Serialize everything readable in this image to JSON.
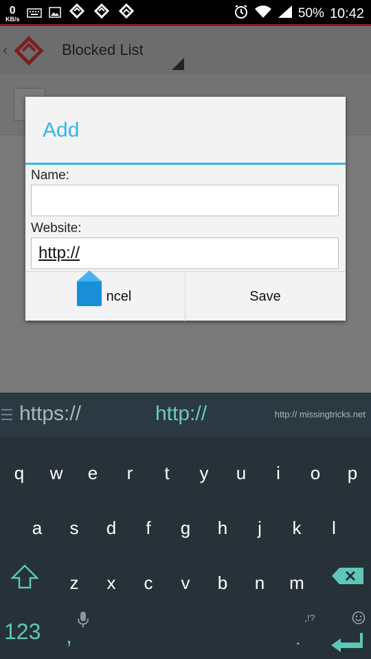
{
  "status_bar": {
    "kbs_value": "0",
    "kbs_unit": "KB/s",
    "battery": "50%",
    "time": "10:42"
  },
  "app_bar": {
    "title": "Blocked List"
  },
  "dialog": {
    "title": "Add",
    "name_label": "Name:",
    "name_value": "",
    "website_label": "Website:",
    "website_value": "http://",
    "cancel_label": "ncel",
    "save_label": "Save"
  },
  "keyboard": {
    "suggestions": [
      "https://",
      "http://"
    ],
    "watermark": "http:// missingtricks.net",
    "row1": [
      "q",
      "w",
      "e",
      "r",
      "t",
      "y",
      "u",
      "i",
      "o",
      "p"
    ],
    "row2": [
      "a",
      "s",
      "d",
      "f",
      "g",
      "h",
      "j",
      "k",
      "l"
    ],
    "row3": [
      "z",
      "x",
      "c",
      "v",
      "b",
      "n",
      "m"
    ],
    "numbers_key": "123",
    "comma_key": ",",
    "punct_hint": ",!?",
    "period_key": ".",
    "accent_color": "#5fc7b8"
  }
}
